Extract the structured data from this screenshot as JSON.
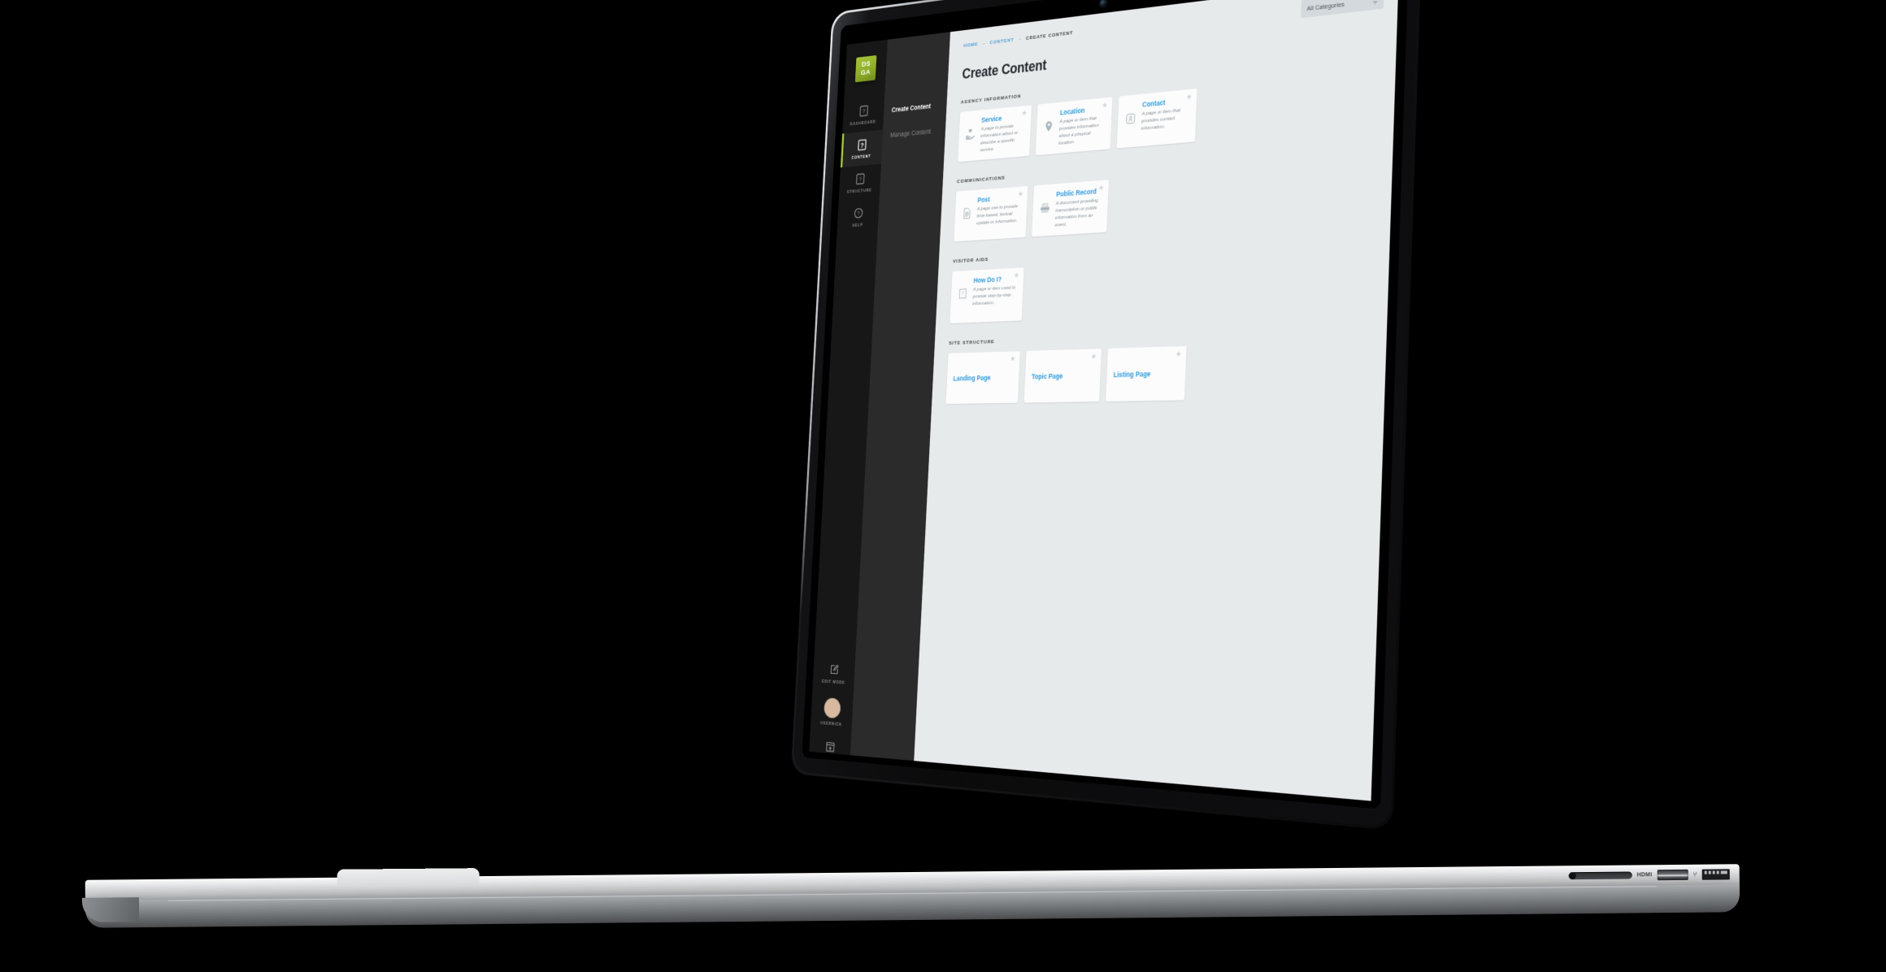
{
  "device": {
    "type": "laptop-mockup",
    "ports": {
      "hdmi_label": "HDMI",
      "usb_glyph": "⑂"
    }
  },
  "rail": {
    "logo": {
      "line1": "DS",
      "line2": "GA",
      "color": "#a4c63c"
    },
    "items": [
      {
        "label": "DASHBOARD",
        "icon": "dashboard-icon",
        "active": false
      },
      {
        "label": "CONTENT",
        "icon": "content-icon",
        "active": true
      },
      {
        "label": "STRUCTURE",
        "icon": "structure-icon",
        "active": false
      },
      {
        "label": "HELP",
        "icon": "help-icon",
        "active": false
      }
    ],
    "bottom": [
      {
        "label": "EDIT MODE",
        "icon": "edit-mode-icon"
      },
      {
        "label": "USERNICK",
        "icon": "avatar"
      }
    ]
  },
  "subnav": {
    "items": [
      {
        "label": "Create Content",
        "active": true
      },
      {
        "label": "Manage Content",
        "active": false
      }
    ]
  },
  "breadcrumb": {
    "items": [
      {
        "label": "HOME",
        "link": true
      },
      {
        "label": "CONTENT",
        "link": true
      },
      {
        "label": "CREATE CONTENT",
        "link": false
      }
    ]
  },
  "filter": {
    "value": "All Categories"
  },
  "page": {
    "title": "Create Content"
  },
  "sections": [
    {
      "title": "AGENCY INFORMATION",
      "cards": [
        {
          "title": "Service",
          "desc": "A page to provide information about or describe a specific service.",
          "icon": "hand-heart-icon",
          "starred": false
        },
        {
          "title": "Location",
          "desc": "A page or item that provides information about a phsyical location.",
          "icon": "map-pin-icon",
          "starred": false
        },
        {
          "title": "Contact",
          "desc": "A page or item that provides contact information.",
          "icon": "contact-card-icon",
          "starred": false
        }
      ]
    },
    {
      "title": "COMMUNICATIONS",
      "cards": [
        {
          "title": "Post",
          "desc": "A page use to provide time-based, textual update or information.",
          "icon": "document-icon",
          "starred": false
        },
        {
          "title": "Public Record",
          "desc": "A document providing transcription or public information from an event.",
          "icon": "typewriter-icon",
          "starred": false
        }
      ]
    },
    {
      "title": "VISITOR AIDS",
      "cards": [
        {
          "title": "How Do I?",
          "desc": "A page or item used to provide step-by-step information.",
          "icon": "question-box-icon",
          "starred": false
        }
      ]
    },
    {
      "title": "SITE STRUCTURE",
      "cards": [
        {
          "title": "Landing Page",
          "desc": "",
          "icon": "landing-page-icon",
          "starred": false
        },
        {
          "title": "Topic Page",
          "desc": "",
          "icon": "topic-page-icon",
          "starred": false
        },
        {
          "title": "Listing Page",
          "desc": "",
          "icon": "listing-page-icon",
          "starred": false
        }
      ]
    }
  ],
  "colors": {
    "accent_green": "#a4c63c",
    "link_blue": "#2e9bdd",
    "breadcrumb_blue": "#4a9fd8",
    "bg": "#e7eaeb",
    "card": "#fcfcfc"
  }
}
